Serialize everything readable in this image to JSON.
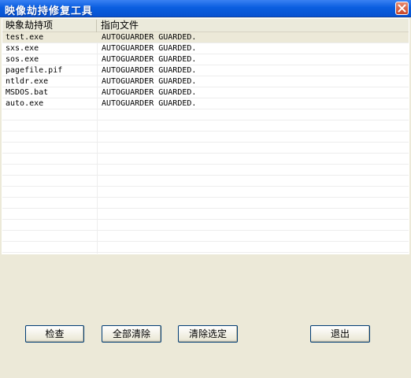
{
  "window": {
    "title": "映像劫持修复工具"
  },
  "list": {
    "columns": [
      "映象劫持项",
      "指向文件"
    ],
    "rows": [
      {
        "name": "test.exe",
        "target": "AUTOGUARDER GUARDED."
      },
      {
        "name": "sxs.exe",
        "target": "AUTOGUARDER GUARDED."
      },
      {
        "name": "sos.exe",
        "target": "AUTOGUARDER GUARDED."
      },
      {
        "name": "pagefile.pif",
        "target": "AUTOGUARDER GUARDED."
      },
      {
        "name": "ntldr.exe",
        "target": "AUTOGUARDER GUARDED."
      },
      {
        "name": "MSDOS.bat",
        "target": "AUTOGUARDER GUARDED."
      },
      {
        "name": "auto.exe",
        "target": "AUTOGUARDER GUARDED."
      }
    ],
    "empty_rows": 14
  },
  "buttons": {
    "check": "检查",
    "clear_all": "全部清除",
    "clear_selected": "清除选定",
    "exit": "退出"
  },
  "icons": {
    "close": "close-icon"
  },
  "colors": {
    "titlebar": "#0a5ee0",
    "window_bg": "#ece9d8",
    "selected_row": "#ece9d8"
  }
}
